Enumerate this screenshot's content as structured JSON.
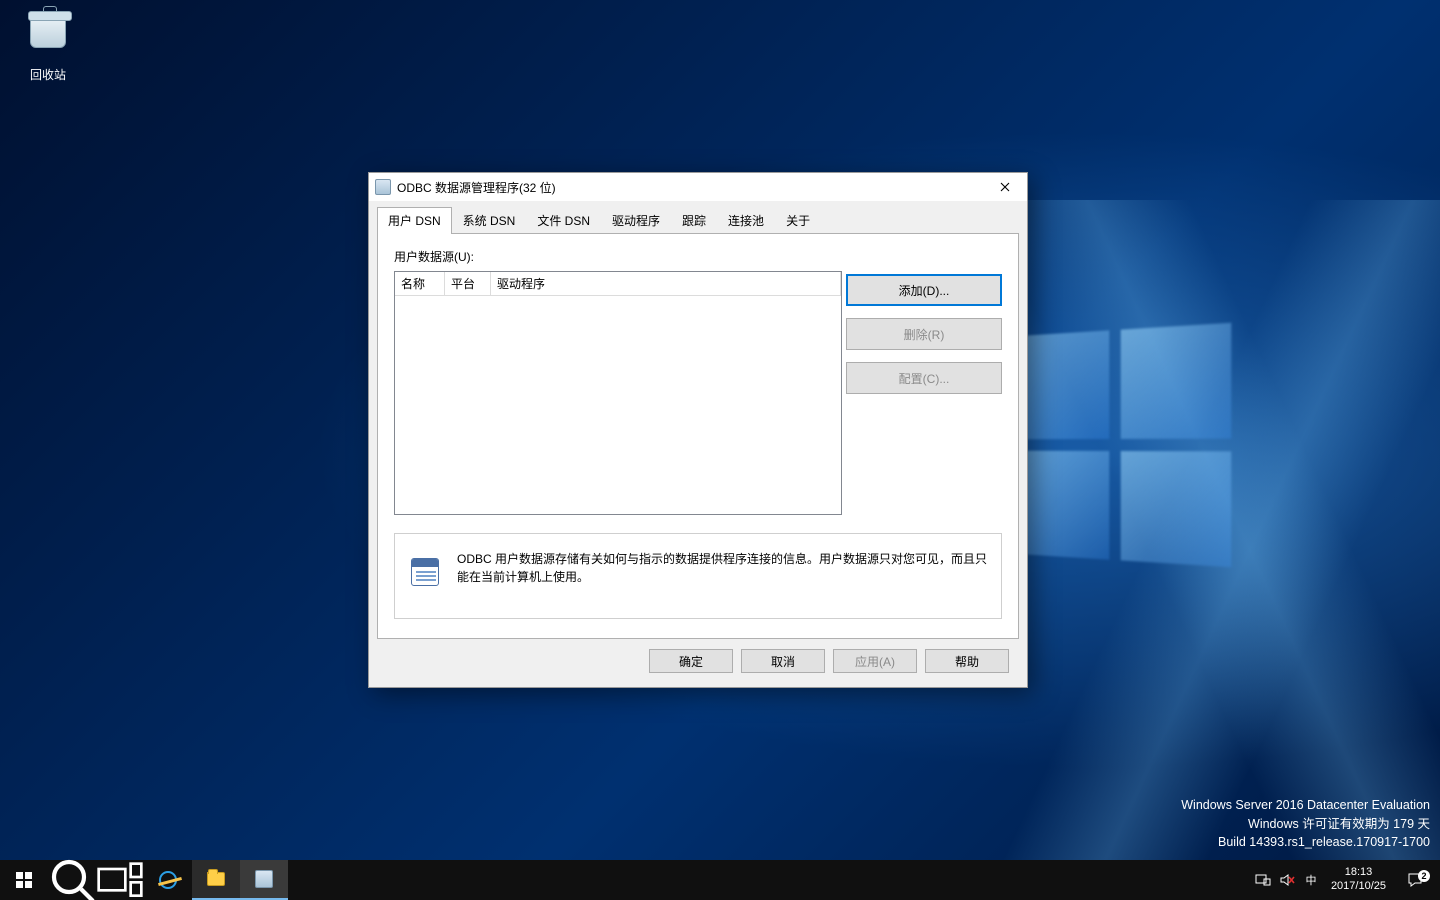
{
  "desktop": {
    "recycle_bin_label": "回收站"
  },
  "dialog": {
    "title": "ODBC 数据源管理程序(32 位)",
    "tabs": [
      "用户 DSN",
      "系统 DSN",
      "文件 DSN",
      "驱动程序",
      "跟踪",
      "连接池",
      "关于"
    ],
    "active_tab_index": 0,
    "list_label": "用户数据源(U):",
    "columns": [
      "名称",
      "平台",
      "驱动程序"
    ],
    "rows": [],
    "buttons": {
      "add": "添加(D)...",
      "remove": "删除(R)",
      "configure": "配置(C)..."
    },
    "info_text": "ODBC 用户数据源存储有关如何与指示的数据提供程序连接的信息。用户数据源只对您可见，而且只能在当前计算机上使用。",
    "footer": {
      "ok": "确定",
      "cancel": "取消",
      "apply": "应用(A)",
      "help": "帮助"
    }
  },
  "watermark": {
    "line1": "Windows Server 2016 Datacenter Evaluation",
    "line2": "Windows 许可证有效期为 179 天",
    "line3": "Build 14393.rs1_release.170917-1700"
  },
  "taskbar": {
    "ime": "中",
    "time": "18:13",
    "date": "2017/10/25",
    "notif_count": "2"
  }
}
